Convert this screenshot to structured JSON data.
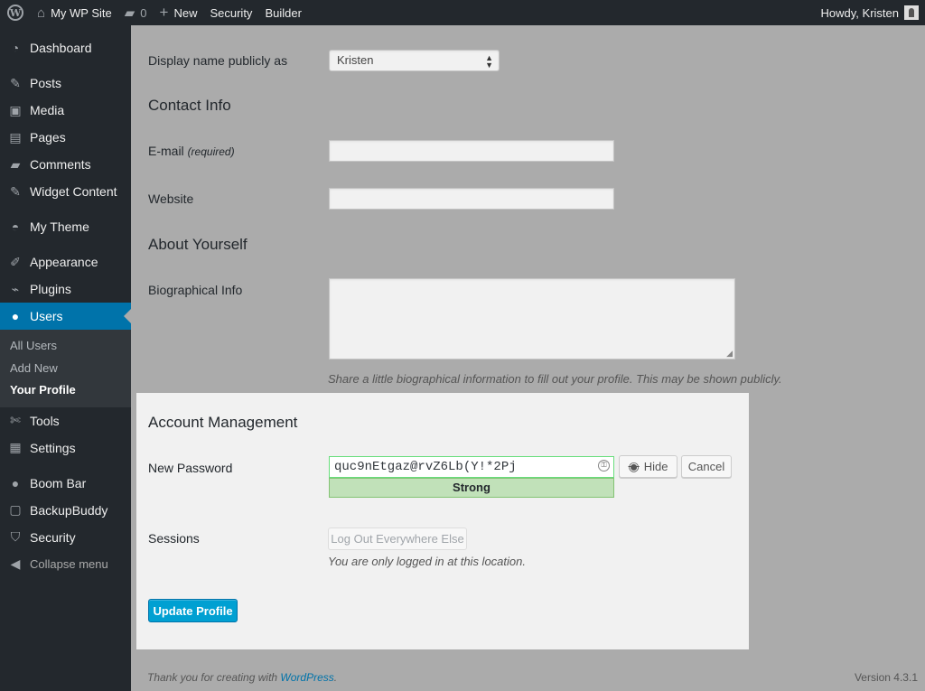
{
  "admin_bar": {
    "site_name": "My WP Site",
    "comments_count": "0",
    "new_label": "New",
    "security_label": "Security",
    "builder_label": "Builder",
    "howdy": "Howdy, Kristen"
  },
  "sidebar": {
    "items": [
      {
        "label": "Dashboard",
        "icon": "dashboard-icon"
      },
      {
        "label": "Posts",
        "icon": "pin-icon"
      },
      {
        "label": "Media",
        "icon": "media-icon"
      },
      {
        "label": "Pages",
        "icon": "pages-icon"
      },
      {
        "label": "Comments",
        "icon": "comments-icon"
      },
      {
        "label": "Widget Content",
        "icon": "pin-icon"
      },
      {
        "label": "My Theme",
        "icon": "theme-icon"
      },
      {
        "label": "Appearance",
        "icon": "brush-icon"
      },
      {
        "label": "Plugins",
        "icon": "plugin-icon"
      },
      {
        "label": "Users",
        "icon": "user-icon"
      },
      {
        "label": "Tools",
        "icon": "wrench-icon"
      },
      {
        "label": "Settings",
        "icon": "settings-icon"
      },
      {
        "label": "Boom Bar",
        "icon": "circle-icon"
      },
      {
        "label": "BackupBuddy",
        "icon": "backup-icon"
      },
      {
        "label": "Security",
        "icon": "shield-icon"
      }
    ],
    "users_submenu": [
      "All Users",
      "Add New",
      "Your Profile"
    ],
    "collapse_label": "Collapse menu"
  },
  "form": {
    "display_name_label": "Display name publicly as",
    "display_name_value": "Kristen",
    "contact_heading": "Contact Info",
    "email_label": "E-mail",
    "email_required": "(required)",
    "website_label": "Website",
    "about_heading": "About Yourself",
    "bio_label": "Biographical Info",
    "bio_desc": "Share a little biographical information to fill out your profile. This may be shown publicly."
  },
  "account": {
    "heading": "Account Management",
    "new_password_label": "New Password",
    "password_value": "quc9nEtgaz@rvZ6Lb(Y!*2Pj",
    "strength": "Strong",
    "hide_label": "Hide",
    "cancel_label": "Cancel",
    "sessions_label": "Sessions",
    "logout_label": "Log Out Everywhere Else",
    "sessions_desc": "You are only logged in at this location.",
    "update_label": "Update Profile"
  },
  "footer": {
    "thanks": "Thank you for creating with",
    "wp_link": "WordPress",
    "period": ".",
    "version": "Version 4.3.1"
  },
  "colors": {
    "admin_dark": "#23282d",
    "active_blue": "#0073aa",
    "primary_button": "#00a0d2",
    "strength_green": "#c1e1b9"
  }
}
